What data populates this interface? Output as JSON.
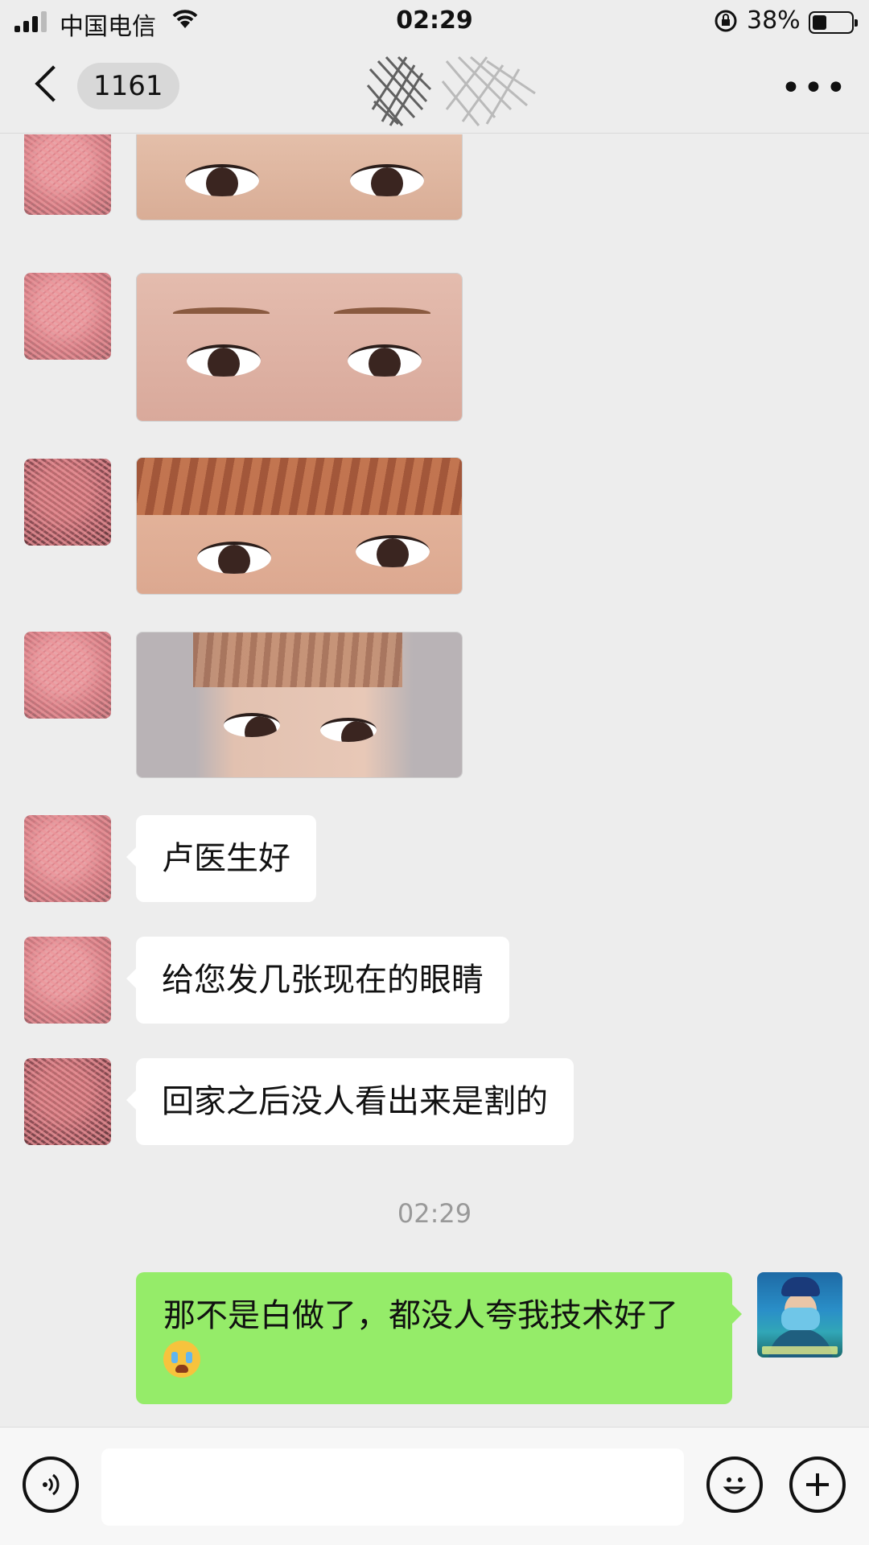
{
  "status_bar": {
    "carrier": "中国电信",
    "time": "02:29",
    "battery": "38%",
    "battery_level": 0.38
  },
  "nav": {
    "unread_count": "1161"
  },
  "messages": {
    "m1": "卢医生好",
    "m2": "给您发几张现在的眼睛",
    "m3": "回家之后没人看出来是割的",
    "timestamp": "02:29",
    "my_reply": "那不是白做了，都没人夸我技术好了"
  },
  "icons": {
    "back": "chevron-left-icon",
    "more": "more-dots-icon",
    "voice": "voice-icon",
    "emoji": "emoji-icon",
    "plus": "plus-icon",
    "crying_emoji": "crying-face-emoji"
  },
  "colors": {
    "background": "#ededed",
    "my_bubble": "#95ec69",
    "their_bubble": "#ffffff"
  }
}
